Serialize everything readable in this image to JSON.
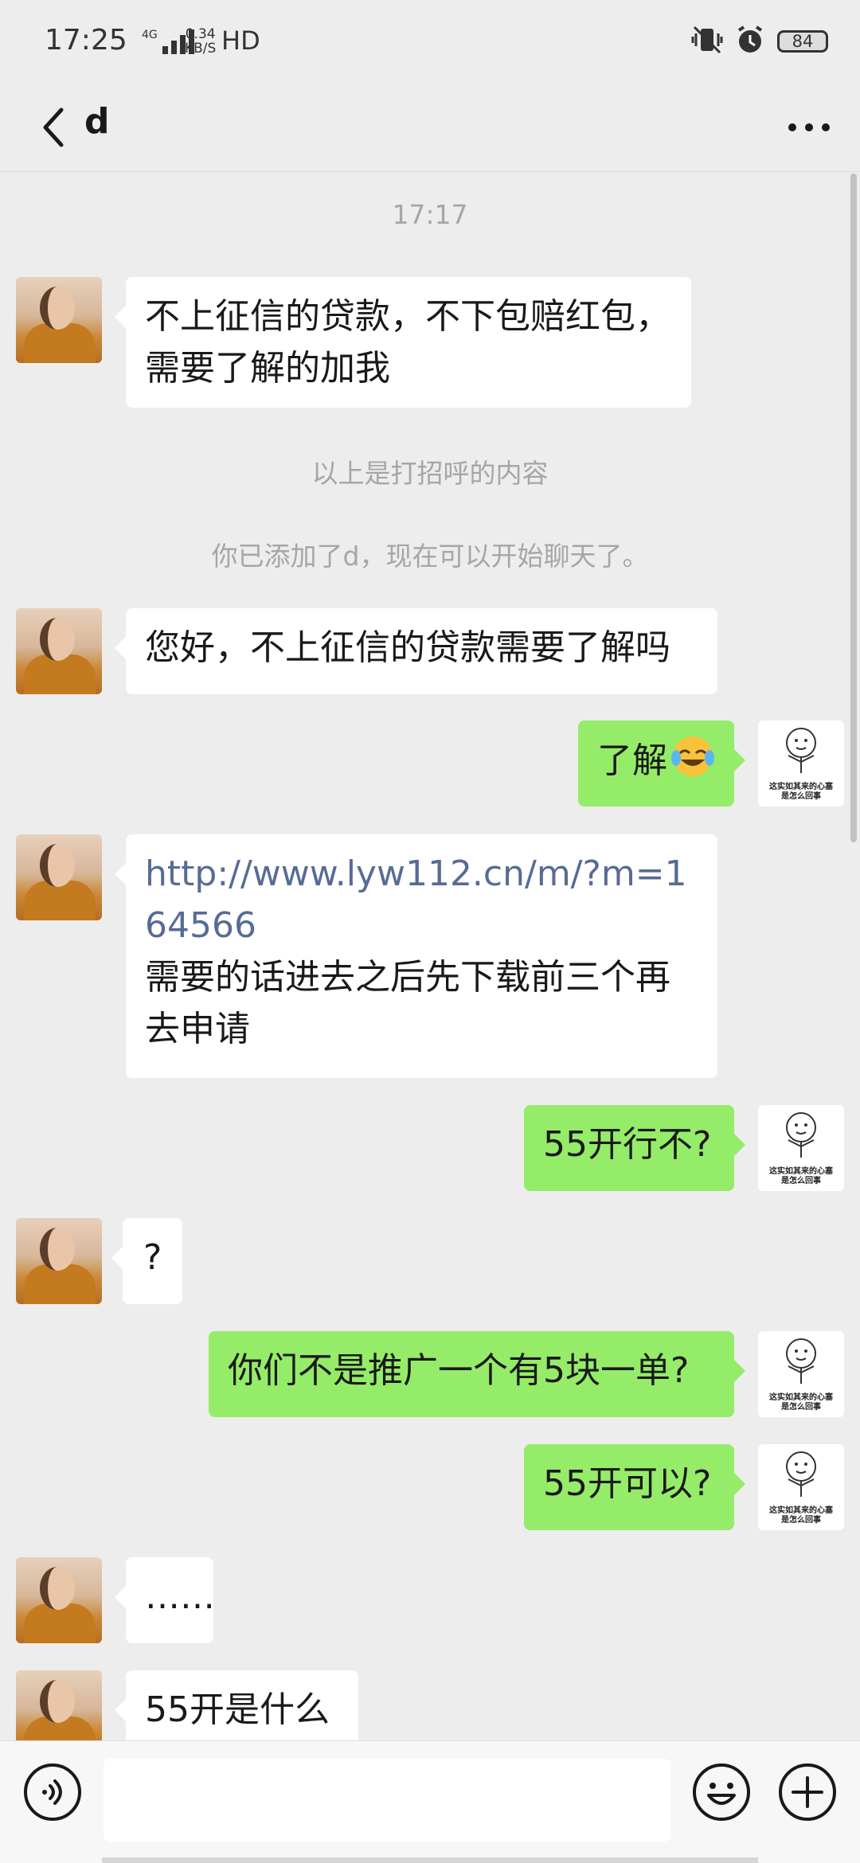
{
  "status_bar": {
    "time": "17:25",
    "network": "4G",
    "speed_value": "0.34",
    "speed_unit": "KB/S",
    "hd": "HD",
    "battery": "84"
  },
  "header": {
    "title": "d"
  },
  "messages": [
    {
      "type": "time",
      "text": "17:17"
    },
    {
      "type": "in",
      "text": "不上征信的贷款，不下包赔红包，需要了解的加我"
    },
    {
      "type": "system",
      "text": "以上是打招呼的内容"
    },
    {
      "type": "system",
      "text": "你已添加了d，现在可以开始聊天了。"
    },
    {
      "type": "in",
      "text": "您好，不上征信的贷款需要了解吗"
    },
    {
      "type": "out",
      "text": "了解",
      "emoji": "tears-of-joy"
    },
    {
      "type": "in",
      "link": "http://www.lyw112.cn/m/?m=164566",
      "text": "需要的话进去之后先下载前三个再去申请"
    },
    {
      "type": "out",
      "text": "55开行不?"
    },
    {
      "type": "in",
      "text": "?"
    },
    {
      "type": "out",
      "text": "你们不是推广一个有5块一单?"
    },
    {
      "type": "out",
      "text": "55开可以?"
    },
    {
      "type": "in",
      "text": "……"
    },
    {
      "type": "in",
      "text": "55开是什么"
    }
  ],
  "me_avatar_caption": [
    "这实如其来的心塞",
    "是怎么回事"
  ],
  "input": {
    "value": "",
    "placeholder": ""
  },
  "icons": {
    "back": "back-arrow-icon",
    "more": "more-dots-icon",
    "voice": "voice-icon",
    "emoji": "emoji-icon",
    "plus": "plus-icon"
  },
  "colors": {
    "background": "#ededed",
    "incoming_bubble": "#ffffff",
    "outgoing_bubble": "#95ec69",
    "link": "#576b95",
    "system_text": "#a6a6a6"
  }
}
